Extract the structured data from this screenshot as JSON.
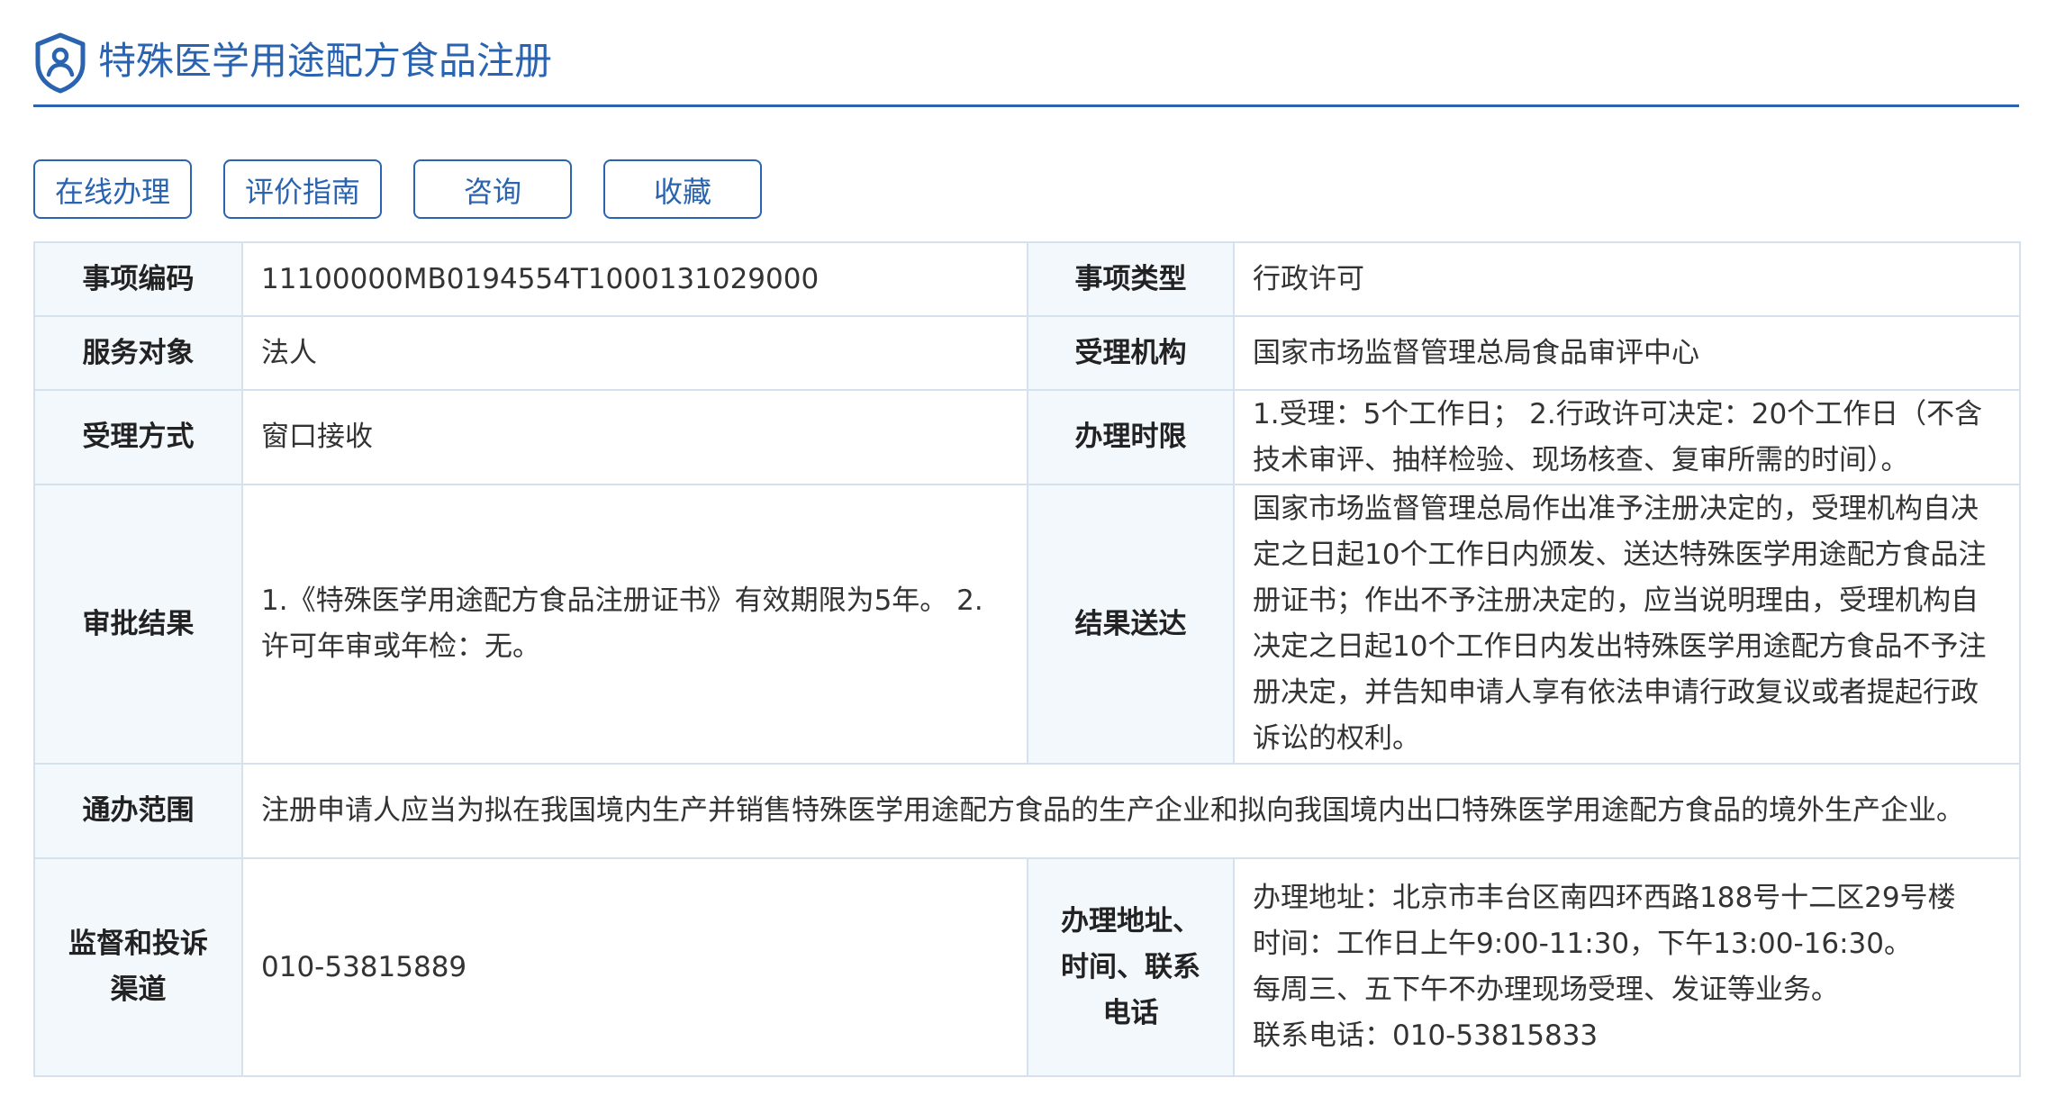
{
  "header": {
    "title": "特殊医学用途配方食品注册",
    "icon": "shield-person-icon",
    "accent_color": "#2a63b0"
  },
  "toolbar": {
    "buttons": [
      {
        "label": "在线办理"
      },
      {
        "label": "评价指南"
      },
      {
        "label": "咨询"
      },
      {
        "label": "收藏"
      }
    ]
  },
  "details": {
    "item_code": {
      "label": "事项编码",
      "value": "11100000MB0194554T1000131029000"
    },
    "item_type": {
      "label": "事项类型",
      "value": "行政许可"
    },
    "service_target": {
      "label": "服务对象",
      "value": "法人"
    },
    "accepting_agency": {
      "label": "受理机构",
      "value": "国家市场监督管理总局食品审评中心"
    },
    "acceptance_method": {
      "label": "受理方式",
      "value": "窗口接收"
    },
    "time_limit": {
      "label": "办理时限",
      "value": "1.受理：5个工作日； 2.行政许可决定：20个工作日（不含技术审评、抽样检验、现场核查、复审所需的时间）。"
    },
    "approval_result": {
      "label": "审批结果",
      "value": "1.《特殊医学用途配方食品注册证书》有效期限为5年。 2.许可年审或年检：无。"
    },
    "result_delivery": {
      "label": "结果送达",
      "value": "国家市场监督管理总局作出准予注册决定的，受理机构自决定之日起10个工作日内颁发、送达特殊医学用途配方食品注册证书；作出不予注册决定的，应当说明理由，受理机构自决定之日起10个工作日内发出特殊医学用途配方食品不予注册决定，并告知申请人享有依法申请行政复议或者提起行政诉讼的权利。"
    },
    "general_scope": {
      "label": "通办范围",
      "value": "注册申请人应当为拟在我国境内生产并销售特殊医学用途配方食品的生产企业和拟向我国境内出口特殊医学用途配方食品的境外生产企业。"
    },
    "supervision": {
      "label": "监督和投诉渠道",
      "value": "010-53815889"
    },
    "contact": {
      "label": "办理地址、时间、联系电话",
      "lines": [
        "办理地址：北京市丰台区南四环西路188号十二区29号楼",
        "时间：工作日上午9:00-11:30，下午13:00-16:30。",
        "每周三、五下午不办理现场受理、发证等业务。",
        "联系电话：010-53815833"
      ]
    }
  }
}
